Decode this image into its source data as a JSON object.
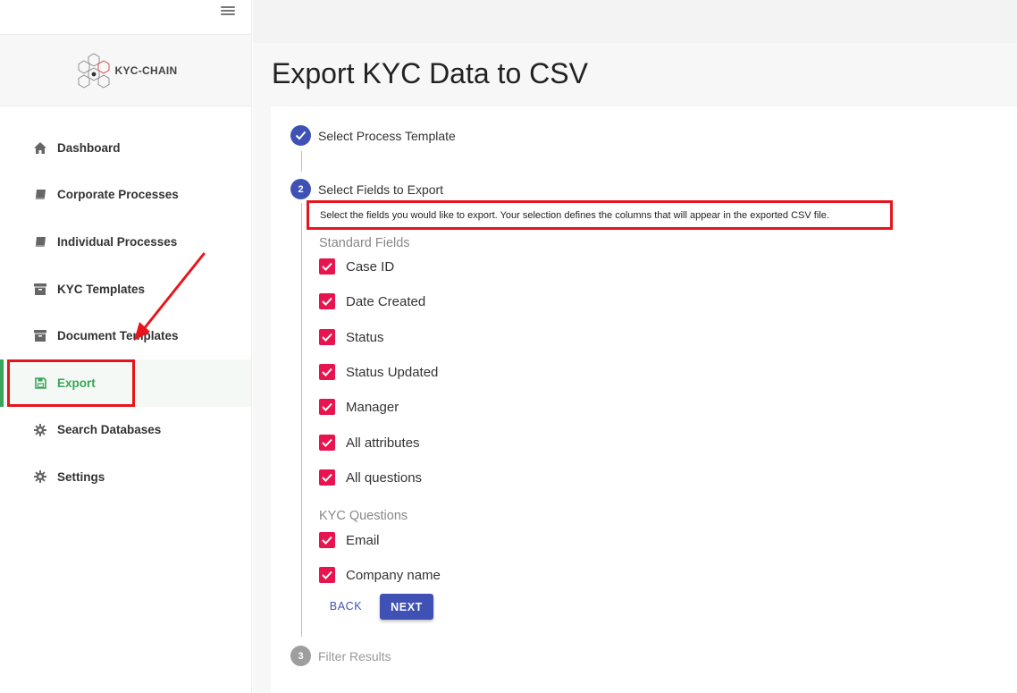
{
  "logo": {
    "text": "KYC-CHAIN"
  },
  "sidebar": {
    "items": [
      {
        "label": "Dashboard",
        "icon": "home-icon"
      },
      {
        "label": "Corporate Processes",
        "icon": "book-icon"
      },
      {
        "label": "Individual Processes",
        "icon": "book-icon"
      },
      {
        "label": "KYC Templates",
        "icon": "archive-icon"
      },
      {
        "label": "Document Templates",
        "icon": "archive-icon"
      },
      {
        "label": "Export",
        "icon": "floppy-disk-icon",
        "active": true
      },
      {
        "label": "Search Databases",
        "icon": "gear-icon"
      },
      {
        "label": "Settings",
        "icon": "gear-icon"
      }
    ]
  },
  "page": {
    "title": "Export KYC Data to CSV"
  },
  "stepper": {
    "steps": [
      {
        "number": "1",
        "label": "Select Process Template",
        "state": "completed"
      },
      {
        "number": "2",
        "label": "Select Fields to Export",
        "state": "active"
      },
      {
        "number": "3",
        "label": "Filter Results",
        "state": "pending"
      }
    ],
    "hint": "Select the fields you would like to export. Your selection defines the columns that will appear in the exported CSV file."
  },
  "fields": {
    "standard_label": "Standard Fields",
    "standard": [
      {
        "label": "Case ID",
        "checked": true
      },
      {
        "label": "Date Created",
        "checked": true
      },
      {
        "label": "Status",
        "checked": true
      },
      {
        "label": "Status Updated",
        "checked": true
      },
      {
        "label": "Manager",
        "checked": true
      },
      {
        "label": "All attributes",
        "checked": true
      },
      {
        "label": "All questions",
        "checked": true
      }
    ],
    "kyc_label": "KYC Questions",
    "kyc": [
      {
        "label": "Email",
        "checked": true
      },
      {
        "label": "Company name",
        "checked": true
      }
    ]
  },
  "buttons": {
    "back": "BACK",
    "next": "NEXT"
  },
  "colors": {
    "primary": "#3f51b5",
    "checkbox": "#e8144f",
    "active_nav": "#3aa55a",
    "annotation": "#e8141b"
  }
}
